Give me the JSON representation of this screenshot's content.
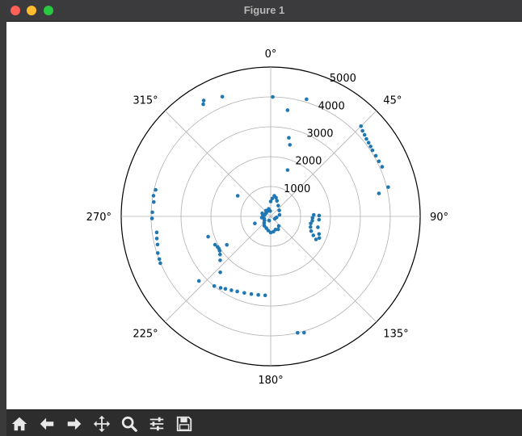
{
  "window": {
    "title": "Figure 1"
  },
  "toolbar": {
    "buttons": [
      {
        "name": "home-button",
        "icon": "home-icon"
      },
      {
        "name": "back-button",
        "icon": "arrow-left-icon"
      },
      {
        "name": "forward-button",
        "icon": "arrow-right-icon"
      },
      {
        "name": "pan-button",
        "icon": "move-icon"
      },
      {
        "name": "zoom-button",
        "icon": "magnifier-icon"
      },
      {
        "name": "configure-subplots-button",
        "icon": "sliders-icon"
      },
      {
        "name": "save-button",
        "icon": "floppy-disk-icon"
      }
    ]
  },
  "chart_data": {
    "type": "scatter",
    "projection": "polar",
    "theta_zero_location": "N",
    "theta_direction": "clockwise",
    "rlim": [
      0,
      5000
    ],
    "r_ticks": [
      1000,
      2000,
      3000,
      4000,
      5000
    ],
    "r_tick_labels": [
      "1000",
      "2000",
      "3000",
      "4000",
      "5000"
    ],
    "theta_ticks_deg": [
      0,
      45,
      90,
      135,
      180,
      225,
      270,
      315
    ],
    "theta_tick_labels": [
      "0°",
      "45°",
      "90°",
      "135°",
      "180°",
      "225°",
      "270°",
      "315°"
    ],
    "grid": true,
    "marker_color": "#1f77b4",
    "points": [
      {
        "theta": 1,
        "r": 4000
      },
      {
        "theta": 17,
        "r": 4100
      },
      {
        "theta": 9,
        "r": 3600
      },
      {
        "theta": 13,
        "r": 2700
      },
      {
        "theta": 15,
        "r": 2480
      },
      {
        "theta": 20,
        "r": 1650
      },
      {
        "theta": 329,
        "r": 4380
      },
      {
        "theta": 330,
        "r": 4480
      },
      {
        "theta": 338,
        "r": 4320
      },
      {
        "theta": 302,
        "r": 1300
      },
      {
        "theta": 45,
        "r": 4270
      },
      {
        "theta": 47,
        "r": 4200
      },
      {
        "theta": 49,
        "r": 4160
      },
      {
        "theta": 51,
        "r": 4120
      },
      {
        "theta": 53,
        "r": 4100
      },
      {
        "theta": 55,
        "r": 4080
      },
      {
        "theta": 57,
        "r": 4060
      },
      {
        "theta": 60,
        "r": 4060
      },
      {
        "theta": 63,
        "r": 4060
      },
      {
        "theta": 66,
        "r": 4080
      },
      {
        "theta": 76,
        "r": 4050
      },
      {
        "theta": 78,
        "r": 3700
      },
      {
        "theta": 88,
        "r": 1440
      },
      {
        "theta": 92,
        "r": 1400
      },
      {
        "theta": 96,
        "r": 1400
      },
      {
        "theta": 100,
        "r": 1360
      },
      {
        "theta": 105,
        "r": 1380
      },
      {
        "theta": 110,
        "r": 1440
      },
      {
        "theta": 114,
        "r": 1560
      },
      {
        "theta": 117,
        "r": 1700
      },
      {
        "theta": 89,
        "r": 1620
      },
      {
        "theta": 94,
        "r": 1620
      },
      {
        "theta": 103,
        "r": 1620
      },
      {
        "theta": 110,
        "r": 1720
      },
      {
        "theta": 114,
        "r": 1780
      },
      {
        "theta": 167,
        "r": 4000
      },
      {
        "theta": 164,
        "r": 4050
      },
      {
        "theta": 184,
        "r": 2650
      },
      {
        "theta": 189,
        "r": 2660
      },
      {
        "theta": 194,
        "r": 2680
      },
      {
        "theta": 199,
        "r": 2710
      },
      {
        "theta": 204,
        "r": 2750
      },
      {
        "theta": 208,
        "r": 2800
      },
      {
        "theta": 212,
        "r": 2860
      },
      {
        "theta": 215,
        "r": 2920
      },
      {
        "theta": 219,
        "r": 3000
      },
      {
        "theta": 228,
        "r": 3230
      },
      {
        "theta": 222,
        "r": 2520
      },
      {
        "theta": 229,
        "r": 2240
      },
      {
        "theta": 233,
        "r": 2120
      },
      {
        "theta": 236,
        "r": 2060
      },
      {
        "theta": 238,
        "r": 2040
      },
      {
        "theta": 240,
        "r": 2050
      },
      {
        "theta": 243,
        "r": 2090
      },
      {
        "theta": 252,
        "r": 2200
      },
      {
        "theta": 237,
        "r": 1750
      },
      {
        "theta": 246,
        "r": 580
      },
      {
        "theta": 247,
        "r": 4010
      },
      {
        "theta": 249,
        "r": 3990
      },
      {
        "theta": 256,
        "r": 3900
      },
      {
        "theta": 259,
        "r": 3880
      },
      {
        "theta": 262,
        "r": 3850
      },
      {
        "theta": 252,
        "r": 3970
      },
      {
        "theta": 269,
        "r": 3970
      },
      {
        "theta": 272,
        "r": 3960
      },
      {
        "theta": 277,
        "r": 3940
      },
      {
        "theta": 280,
        "r": 3980
      },
      {
        "theta": 283,
        "r": 3950
      },
      {
        "theta": 0,
        "r": 500
      },
      {
        "theta": 5,
        "r": 600
      },
      {
        "theta": 10,
        "r": 700
      },
      {
        "theta": 16,
        "r": 650
      },
      {
        "theta": 22,
        "r": 560
      },
      {
        "theta": 35,
        "r": 440
      },
      {
        "theta": 55,
        "r": 350
      },
      {
        "theta": 80,
        "r": 300
      },
      {
        "theta": 140,
        "r": 420
      },
      {
        "theta": 150,
        "r": 500
      },
      {
        "theta": 160,
        "r": 470
      },
      {
        "theta": 170,
        "r": 520
      },
      {
        "theta": 180,
        "r": 540
      },
      {
        "theta": 190,
        "r": 480
      },
      {
        "theta": 200,
        "r": 420
      },
      {
        "theta": 214,
        "r": 380
      },
      {
        "theta": 225,
        "r": 310
      },
      {
        "theta": 238,
        "r": 250
      },
      {
        "theta": 250,
        "r": 230
      },
      {
        "theta": 262,
        "r": 300
      },
      {
        "theta": 275,
        "r": 260
      },
      {
        "theta": 282,
        "r": 210
      },
      {
        "theta": 290,
        "r": 300
      },
      {
        "theta": 305,
        "r": 190
      },
      {
        "theta": 320,
        "r": 250
      },
      {
        "theta": 335,
        "r": 200
      },
      {
        "theta": 345,
        "r": 260
      },
      {
        "theta": 355,
        "r": 180
      },
      {
        "theta": 100,
        "r": 200
      },
      {
        "theta": 120,
        "r": 160
      },
      {
        "theta": 200,
        "r": 150
      }
    ]
  }
}
